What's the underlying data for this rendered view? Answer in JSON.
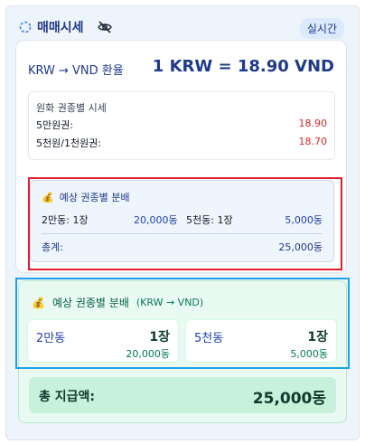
{
  "header": {
    "title": "매매시세",
    "badge": "실시간",
    "refresh_icon": "refresh-icon",
    "visibility_icon": "eye-off-icon"
  },
  "rate": {
    "label": "KRW → VND 환율",
    "value": "1 KRW = 18.90 VND"
  },
  "price_box": {
    "title": "원화 권종별 시세",
    "rows": [
      {
        "label": "5만원권:",
        "value": "18.90"
      },
      {
        "label": "5천원/1천원권:",
        "value": "18.70"
      }
    ]
  },
  "distribution": {
    "title": "예상 권종별 분배",
    "icon": "money-bag-icon",
    "items": [
      {
        "label": "2만동: 1장",
        "amount": "20,000동"
      },
      {
        "label": "5천동: 1장",
        "amount": "5,000동"
      }
    ],
    "total_label": "총계:",
    "total_value": "25,000동"
  },
  "green_section": {
    "title": "예상 권종별 분배",
    "subtitle": "(KRW → VND)",
    "icon": "money-bag-icon",
    "cards": [
      {
        "label": "2만동",
        "count": "1장",
        "amount": "20,000동"
      },
      {
        "label": "5천동",
        "count": "1장",
        "amount": "5,000동"
      }
    ],
    "total_label": "총 지급액:",
    "total_value": "25,000동"
  },
  "colors": {
    "primary": "#1e3a8a",
    "price": "#dc2626",
    "green": "#065f46",
    "highlight_red": "#e11d2e",
    "highlight_blue": "#1ea1e6"
  }
}
